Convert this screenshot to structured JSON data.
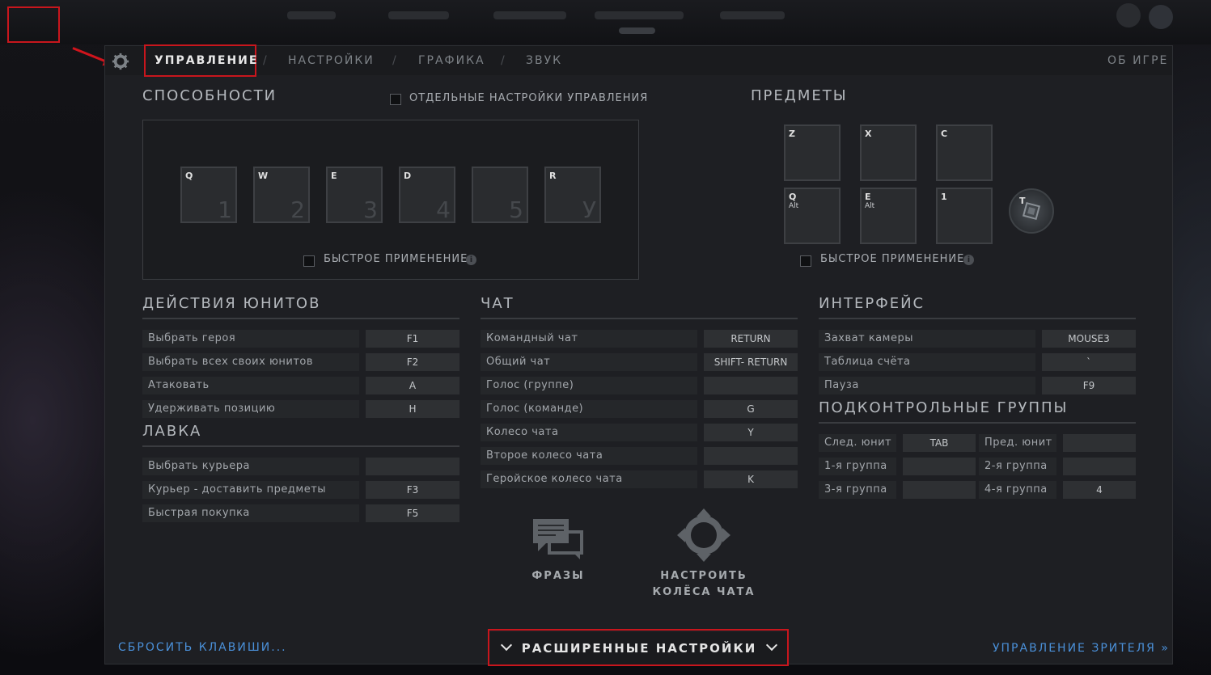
{
  "tabs": {
    "controls": "УПРАВЛЕНИЕ",
    "options": "НАСТРОЙКИ",
    "video": "ГРАФИКА",
    "audio": "ЗВУК",
    "about": "ОБ ИГРЕ",
    "separator": "/"
  },
  "abilities": {
    "title": "СПОСОБНОСТИ",
    "separate_controls_label": "ОТДЕЛЬНЫЕ НАСТРОЙКИ УПРАВЛЕНИЯ",
    "quickcast_label": "БЫСТРОЕ ПРИМЕНЕНИЕ",
    "slots": [
      {
        "key": "Q",
        "num": "1"
      },
      {
        "key": "W",
        "num": "2"
      },
      {
        "key": "E",
        "num": "3"
      },
      {
        "key": "D",
        "num": "4"
      },
      {
        "key": "",
        "num": "5"
      },
      {
        "key": "R",
        "num": "У"
      }
    ]
  },
  "items": {
    "title": "ПРЕДМЕТЫ",
    "quickcast_label": "БЫСТРОЕ ПРИМЕНЕНИЕ",
    "slots": [
      {
        "key": "Z",
        "mod": ""
      },
      {
        "key": "X",
        "mod": ""
      },
      {
        "key": "C",
        "mod": ""
      },
      {
        "key": "Q",
        "mod": "Alt"
      },
      {
        "key": "E",
        "mod": "Alt"
      },
      {
        "key": "1",
        "mod": ""
      }
    ],
    "tp_key": "T"
  },
  "unit_actions": {
    "title": "ДЕЙСТВИЯ ЮНИТОВ",
    "rows": [
      {
        "name": "Выбрать героя",
        "key": "F1"
      },
      {
        "name": "Выбрать всех своих юнитов",
        "key": "F2"
      },
      {
        "name": "Атаковать",
        "key": "A"
      },
      {
        "name": "Удерживать позицию",
        "key": "H"
      }
    ]
  },
  "shop": {
    "title": "ЛАВКА",
    "rows": [
      {
        "name": "Выбрать курьера",
        "key": ""
      },
      {
        "name": "Курьер - доставить предметы",
        "key": "F3"
      },
      {
        "name": "Быстрая покупка",
        "key": "F5"
      }
    ]
  },
  "chat": {
    "title": "ЧАТ",
    "rows": [
      {
        "name": "Командный чат",
        "key": "RETURN"
      },
      {
        "name": "Общий чат",
        "key": "SHIFT- RETURN"
      },
      {
        "name": "Голос (группе)",
        "key": ""
      },
      {
        "name": "Голос (команде)",
        "key": "G"
      },
      {
        "name": "Колесо чата",
        "key": "Y"
      },
      {
        "name": "Второе колесо чата",
        "key": ""
      },
      {
        "name": "Геройское колесо чата",
        "key": "K"
      }
    ],
    "phrases_label": "ФРАЗЫ",
    "wheel_label_1": "НАСТРОИТЬ",
    "wheel_label_2": "КОЛЁСА ЧАТА"
  },
  "interface": {
    "title": "ИНТЕРФЕЙС",
    "rows": [
      {
        "name": "Захват камеры",
        "key": "MOUSE3"
      },
      {
        "name": "Таблица счёта",
        "key": "`"
      },
      {
        "name": "Пауза",
        "key": "F9"
      }
    ]
  },
  "control_groups": {
    "title": "ПОДКОНТРОЛЬНЫЕ ГРУППЫ",
    "rows": [
      {
        "name1": "След. юнит",
        "key1": "TAB",
        "name2": "Пред. юнит",
        "key2": ""
      },
      {
        "name1": "1-я группа",
        "key1": "",
        "name2": "2-я группа",
        "key2": ""
      },
      {
        "name1": "3-я группа",
        "key1": "",
        "name2": "4-я группа",
        "key2": "4"
      }
    ]
  },
  "footer": {
    "reset": "СБРОСИТЬ КЛАВИШИ...",
    "advanced": "РАСШИРЕННЫЕ НАСТРОЙКИ",
    "spectator": "УПРАВЛЕНИЕ ЗРИТЕЛЯ",
    "spectator_arrow": "»"
  },
  "colors": {
    "accent_blue": "#4a90d9",
    "highlight_red": "#c8161d",
    "panel_bg": "#1e1f23"
  }
}
